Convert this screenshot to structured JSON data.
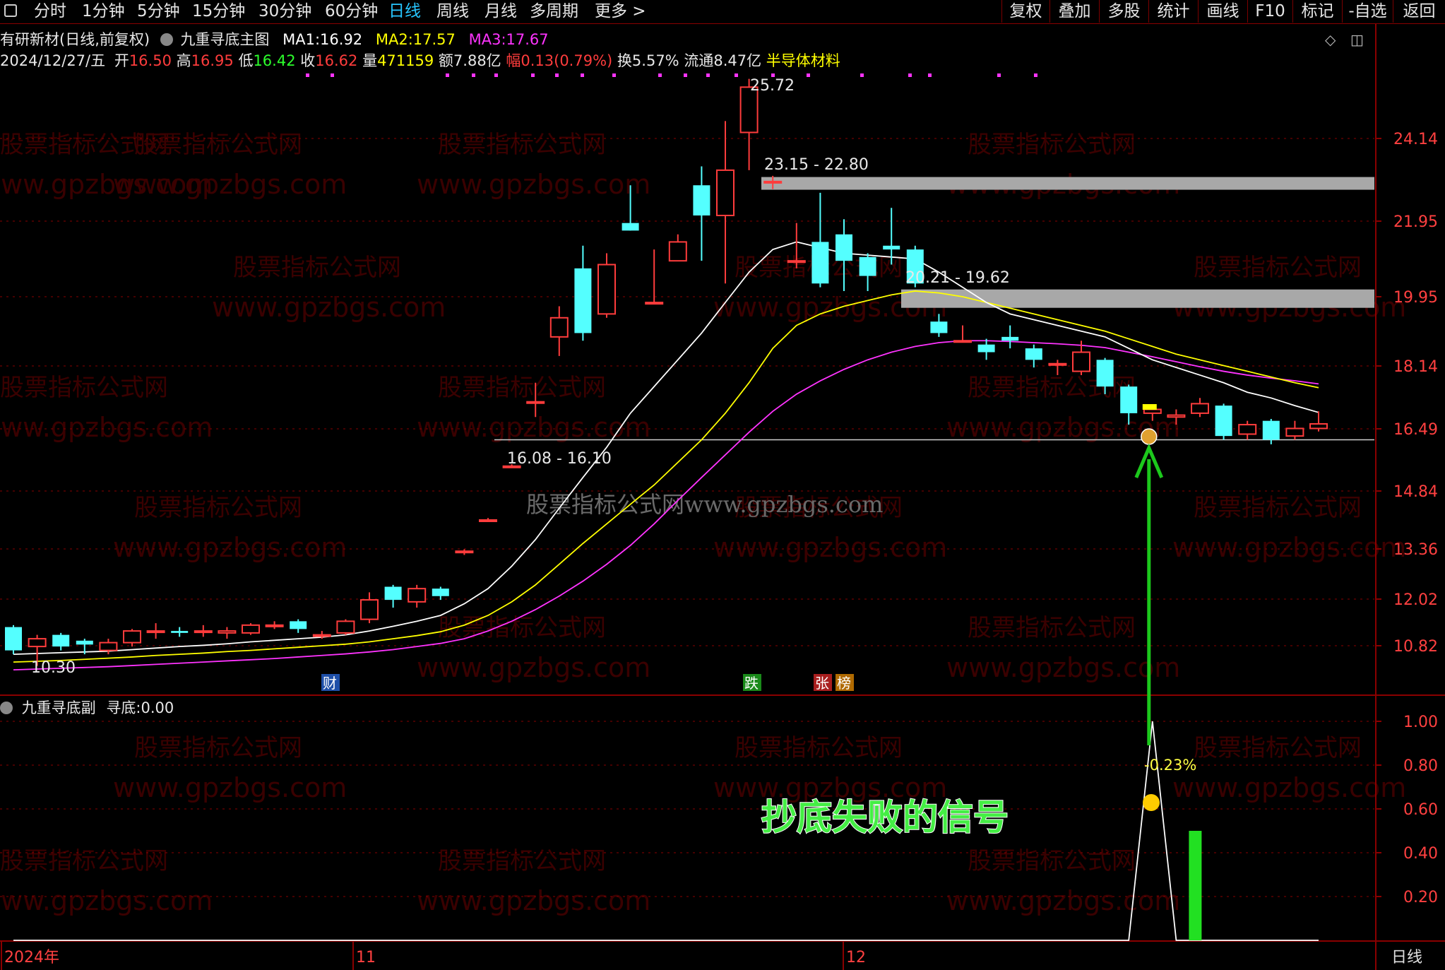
{
  "toolbar": {
    "left_icon": "window-icon",
    "periods": [
      "分时",
      "1分钟",
      "5分钟",
      "15分钟",
      "30分钟",
      "60分钟",
      "日线",
      "周线",
      "月线",
      "多周期",
      "更多 >"
    ],
    "active_period": "日线",
    "right_buttons": [
      "复权",
      "叠加",
      "多股",
      "统计",
      "画线",
      "F10",
      "标记",
      "-自选",
      "返回"
    ]
  },
  "header": {
    "stock": "有研新材(日线,前复权)",
    "indicator": "九重寻底主图",
    "ma1_label": "MA1:",
    "ma1": "16.92",
    "ma2_label": "MA2:",
    "ma2": "17.57",
    "ma3_label": "MA3:",
    "ma3": "17.67"
  },
  "quote": {
    "date": "2024/12/27/五",
    "open_label": "开",
    "open": "16.50",
    "high_label": "高",
    "high": "16.95",
    "low_label": "低",
    "low": "16.42",
    "close_label": "收",
    "close": "16.62",
    "vol_label": "量",
    "vol": "471159",
    "amount": "额7.88亿",
    "change": "幅0.13(0.79%)",
    "turnover": "换5.57%",
    "float": "流通8.47亿",
    "sector": "半导体材料"
  },
  "sub_header": {
    "indicator": "九重寻底副",
    "label": "寻底:",
    "value": "0.00"
  },
  "watermarks": [
    "股票指标公式网",
    "www.gpzbgs.com",
    "股票指标公式网www.gpzbgs.com"
  ],
  "annotation_text": "抄底失败的信号",
  "colors": {
    "up": "#ff3c3c",
    "down": "#54ffff",
    "ma1": "#ffffff",
    "ma2": "#ffff00",
    "ma3": "#ff33ff",
    "grid": "#8a0000",
    "axis_text": "#ff4040",
    "highlight_band": "#a8a8a8",
    "arrow": "#1cc81c",
    "signal_bar": "#22e022",
    "pct_text": "#ffff44"
  },
  "chart_data": {
    "type": "candlestick",
    "y_ticks": [
      "24.14",
      "21.95",
      "19.95",
      "18.14",
      "16.49",
      "14.84",
      "13.36",
      "12.02",
      "10.82"
    ],
    "sub_y_ticks": [
      "1.00",
      "0.80",
      "0.60",
      "0.40",
      "0.20"
    ],
    "x_labels": [
      "2024年",
      "11",
      "12"
    ],
    "right_bottom_label": "日线",
    "price_labels": {
      "high": "25.72",
      "low": "10.30",
      "zone1": "23.15 - 22.80",
      "zone2": "20.21 - 19.62",
      "zone3": "16.08 - 16.10"
    },
    "event_tags": [
      "财",
      "跌",
      "张",
      "榜"
    ],
    "signal_pct": "-0.23%",
    "candles": [
      {
        "o": 11.3,
        "c": 10.7,
        "h": 11.35,
        "l": 10.6
      },
      {
        "o": 10.8,
        "c": 11.0,
        "h": 11.1,
        "l": 10.3
      },
      {
        "o": 11.1,
        "c": 10.8,
        "h": 11.15,
        "l": 10.7
      },
      {
        "o": 10.95,
        "c": 10.85,
        "h": 11.0,
        "l": 10.6
      },
      {
        "o": 10.7,
        "c": 10.9,
        "h": 11.0,
        "l": 10.6
      },
      {
        "o": 10.9,
        "c": 11.2,
        "h": 11.25,
        "l": 10.8
      },
      {
        "o": 11.2,
        "c": 11.2,
        "h": 11.4,
        "l": 11.0
      },
      {
        "o": 11.2,
        "c": 11.15,
        "h": 11.3,
        "l": 11.05
      },
      {
        "o": 11.2,
        "c": 11.2,
        "h": 11.35,
        "l": 11.05
      },
      {
        "o": 11.15,
        "c": 11.2,
        "h": 11.3,
        "l": 11.0
      },
      {
        "o": 11.15,
        "c": 11.35,
        "h": 11.4,
        "l": 11.1
      },
      {
        "o": 11.35,
        "c": 11.35,
        "h": 11.45,
        "l": 11.25
      },
      {
        "o": 11.45,
        "c": 11.25,
        "h": 11.5,
        "l": 11.15
      },
      {
        "o": 11.1,
        "c": 11.1,
        "h": 11.2,
        "l": 11.0
      },
      {
        "o": 11.15,
        "c": 11.45,
        "h": 11.5,
        "l": 11.1
      },
      {
        "o": 11.5,
        "c": 12.0,
        "h": 12.2,
        "l": 11.4
      },
      {
        "o": 12.35,
        "c": 12.0,
        "h": 12.4,
        "l": 11.8
      },
      {
        "o": 11.95,
        "c": 12.3,
        "h": 12.4,
        "l": 11.8
      },
      {
        "o": 12.3,
        "c": 12.1,
        "h": 12.35,
        "l": 12.0
      },
      {
        "o": 13.3,
        "c": 13.3,
        "h": 13.35,
        "l": 13.2
      },
      {
        "o": 14.1,
        "c": 14.1,
        "h": 14.15,
        "l": 14.05
      },
      {
        "o": 15.5,
        "c": 15.5,
        "h": 15.55,
        "l": 15.45
      },
      {
        "o": 17.2,
        "c": 17.2,
        "h": 17.7,
        "l": 16.8
      },
      {
        "o": 18.9,
        "c": 19.4,
        "h": 19.7,
        "l": 18.4
      },
      {
        "o": 20.7,
        "c": 19.0,
        "h": 21.3,
        "l": 18.8
      },
      {
        "o": 19.5,
        "c": 20.8,
        "h": 21.1,
        "l": 19.4
      },
      {
        "o": 21.9,
        "c": 21.7,
        "h": 22.9,
        "l": 21.7
      },
      {
        "o": 19.8,
        "c": 19.8,
        "h": 21.2,
        "l": 19.8
      },
      {
        "o": 20.9,
        "c": 21.4,
        "h": 21.6,
        "l": 20.9
      },
      {
        "o": 22.9,
        "c": 22.1,
        "h": 23.4,
        "l": 20.9
      },
      {
        "o": 22.1,
        "c": 23.3,
        "h": 24.6,
        "l": 20.3
      },
      {
        "o": 24.3,
        "c": 25.5,
        "h": 25.72,
        "l": 23.3
      },
      {
        "o": 23.0,
        "c": 23.0,
        "h": 23.15,
        "l": 22.8
      },
      {
        "o": 20.9,
        "c": 20.9,
        "h": 21.9,
        "l": 20.7
      },
      {
        "o": 21.4,
        "c": 20.3,
        "h": 22.7,
        "l": 20.2
      },
      {
        "o": 21.6,
        "c": 20.9,
        "h": 22.0,
        "l": 20.1
      },
      {
        "o": 21.0,
        "c": 20.5,
        "h": 21.1,
        "l": 20.1
      },
      {
        "o": 21.3,
        "c": 21.2,
        "h": 22.3,
        "l": 20.8
      },
      {
        "o": 21.2,
        "c": 20.3,
        "h": 21.3,
        "l": 20.2
      },
      {
        "o": 19.3,
        "c": 19.0,
        "h": 19.5,
        "l": 18.9
      },
      {
        "o": 18.8,
        "c": 18.8,
        "h": 19.2,
        "l": 18.8
      },
      {
        "o": 18.7,
        "c": 18.5,
        "h": 18.85,
        "l": 18.3
      },
      {
        "o": 18.9,
        "c": 18.8,
        "h": 19.2,
        "l": 18.6
      },
      {
        "o": 18.6,
        "c": 18.3,
        "h": 18.7,
        "l": 18.1
      },
      {
        "o": 18.2,
        "c": 18.2,
        "h": 18.3,
        "l": 17.9
      },
      {
        "o": 18.0,
        "c": 18.5,
        "h": 18.8,
        "l": 17.9
      },
      {
        "o": 18.3,
        "c": 17.6,
        "h": 18.35,
        "l": 17.4
      },
      {
        "o": 17.6,
        "c": 16.9,
        "h": 17.65,
        "l": 16.6
      },
      {
        "o": 16.9,
        "c": 17.0,
        "h": 17.1,
        "l": 16.7
      },
      {
        "o": 16.8,
        "c": 16.85,
        "h": 17.0,
        "l": 16.6
      },
      {
        "o": 16.9,
        "c": 17.15,
        "h": 17.3,
        "l": 16.8
      },
      {
        "o": 17.1,
        "c": 16.3,
        "h": 17.15,
        "l": 16.2
      },
      {
        "o": 16.35,
        "c": 16.6,
        "h": 16.7,
        "l": 16.2
      },
      {
        "o": 16.7,
        "c": 16.2,
        "h": 16.75,
        "l": 16.08
      },
      {
        "o": 16.3,
        "c": 16.5,
        "h": 16.7,
        "l": 16.2
      },
      {
        "o": 16.5,
        "c": 16.62,
        "h": 16.95,
        "l": 16.42
      }
    ],
    "ma1": [
      10.6,
      10.62,
      10.64,
      10.66,
      10.68,
      10.72,
      10.76,
      10.8,
      10.83,
      10.87,
      10.92,
      10.96,
      11.0,
      11.04,
      11.1,
      11.2,
      11.32,
      11.45,
      11.6,
      11.9,
      12.3,
      12.9,
      13.6,
      14.4,
      15.2,
      16.0,
      16.9,
      17.6,
      18.3,
      19.0,
      19.8,
      20.6,
      21.2,
      21.4,
      21.25,
      21.1,
      21.05,
      21.0,
      20.95,
      20.6,
      20.2,
      19.8,
      19.5,
      19.35,
      19.2,
      19.05,
      18.9,
      18.6,
      18.3,
      18.1,
      17.9,
      17.7,
      17.45,
      17.3,
      17.1,
      16.92
    ],
    "ma2": [
      10.4,
      10.42,
      10.44,
      10.47,
      10.5,
      10.53,
      10.57,
      10.6,
      10.63,
      10.67,
      10.7,
      10.74,
      10.78,
      10.82,
      10.86,
      10.92,
      11.0,
      11.08,
      11.18,
      11.35,
      11.6,
      11.95,
      12.4,
      12.95,
      13.5,
      14.0,
      14.5,
      15.0,
      15.6,
      16.2,
      16.9,
      17.7,
      18.6,
      19.2,
      19.5,
      19.7,
      19.85,
      20.0,
      20.1,
      20.05,
      19.95,
      19.8,
      19.65,
      19.5,
      19.35,
      19.2,
      19.05,
      18.85,
      18.65,
      18.45,
      18.3,
      18.15,
      18.0,
      17.85,
      17.7,
      17.57
    ],
    "ma3": [
      10.2,
      10.22,
      10.24,
      10.26,
      10.28,
      10.31,
      10.34,
      10.37,
      10.4,
      10.43,
      10.46,
      10.49,
      10.53,
      10.57,
      10.61,
      10.66,
      10.72,
      10.8,
      10.88,
      11.0,
      11.2,
      11.45,
      11.75,
      12.1,
      12.5,
      12.95,
      13.45,
      14.0,
      14.6,
      15.2,
      15.8,
      16.4,
      16.95,
      17.4,
      17.75,
      18.05,
      18.3,
      18.5,
      18.65,
      18.75,
      18.8,
      18.8,
      18.78,
      18.75,
      18.72,
      18.68,
      18.62,
      18.5,
      18.38,
      18.25,
      18.12,
      18.0,
      17.9,
      17.82,
      17.75,
      17.67
    ],
    "signal_line": [
      0,
      0,
      0,
      0,
      0,
      0,
      0,
      0,
      0,
      0,
      0,
      0,
      0,
      0,
      0,
      0,
      0,
      0,
      0,
      0,
      0,
      0,
      0,
      0,
      0,
      0,
      0,
      0,
      0,
      0,
      0,
      0,
      0,
      0,
      0,
      0,
      0,
      0,
      0,
      0,
      0,
      0,
      0,
      0,
      0,
      0,
      0,
      0,
      1.0,
      0,
      0,
      0,
      0,
      0,
      0,
      0
    ],
    "signal_bar": {
      "index": 49,
      "value": 0.5
    }
  }
}
